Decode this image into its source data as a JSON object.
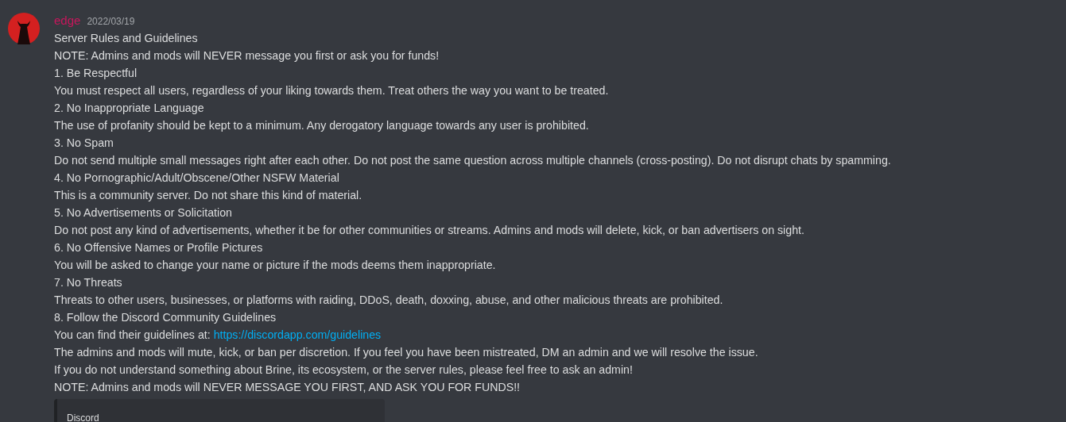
{
  "message": {
    "author": "edge",
    "timestamp": "2022/03/19",
    "lines": [
      {
        "kind": "plain",
        "text": "Server Rules and Guidelines"
      },
      {
        "kind": "plain",
        "text": "NOTE: Admins and mods will NEVER message you first or ask you for funds!"
      },
      {
        "kind": "plain",
        "text": "1. Be Respectful"
      },
      {
        "kind": "plain",
        "text": "You must respect all users, regardless of your liking towards them. Treat others the way you want to be treated."
      },
      {
        "kind": "plain",
        "text": "2. No Inappropriate Language"
      },
      {
        "kind": "plain",
        "text": "The use of profanity should be kept to a minimum. Any derogatory language towards any user is prohibited."
      },
      {
        "kind": "plain",
        "text": "3. No Spam"
      },
      {
        "kind": "plain",
        "text": "Do not send multiple small messages right after each other. Do not post the same question across multiple channels (cross-posting). Do not disrupt chats by spamming."
      },
      {
        "kind": "plain",
        "text": "4. No Pornographic/Adult/Obscene/Other NSFW Material"
      },
      {
        "kind": "plain",
        "text": "This is a community server. Do not share this kind of material."
      },
      {
        "kind": "plain",
        "text": "5. No Advertisements or Solicitation"
      },
      {
        "kind": "plain",
        "text": "Do not post any kind of advertisements, whether it be for other communities or streams. Admins and mods will delete, kick, or ban advertisers on sight."
      },
      {
        "kind": "plain",
        "text": "6. No Offensive Names or Profile Pictures"
      },
      {
        "kind": "plain",
        "text": "You will be asked to change your name or picture if the mods deems them inappropriate."
      },
      {
        "kind": "plain",
        "text": "7. No Threats"
      },
      {
        "kind": "plain",
        "text": "Threats to other users, businesses, or platforms with raiding, DDoS, death, doxxing, abuse, and other malicious threats are prohibited."
      },
      {
        "kind": "plain",
        "text": "8. Follow the Discord Community Guidelines"
      },
      {
        "kind": "link_line",
        "text": "You can find their guidelines at:",
        "link": "https://discordapp.com/guidelines"
      },
      {
        "kind": "plain",
        "text": "The admins and mods will mute, kick, or ban per discretion. If you feel you have been mistreated, DM an admin and we will resolve the issue."
      },
      {
        "kind": "plain",
        "text": "If you do not understand something about Brine, its ecosystem, or the server rules, please feel free to ask an admin!"
      },
      {
        "kind": "plain",
        "text": "NOTE: Admins and mods will NEVER MESSAGE YOU FIRST, AND ASK YOU FOR FUNDS!!"
      }
    ],
    "embed": {
      "provider": "Discord"
    }
  }
}
